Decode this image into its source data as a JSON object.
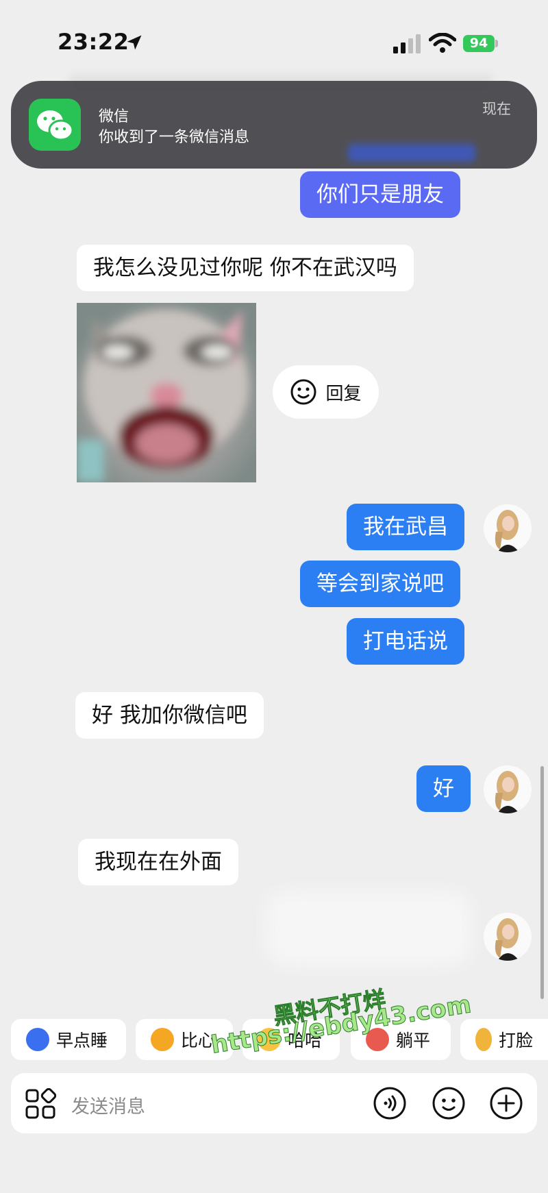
{
  "status_bar": {
    "time": "23:22",
    "battery": "94"
  },
  "notification": {
    "app": "微信",
    "message": "你收到了一条微信消息",
    "time": "现在",
    "icon": "wechat-icon"
  },
  "messages": [
    {
      "side": "sent",
      "text": "你们只是朋友"
    },
    {
      "side": "received",
      "text": "我怎么没见过你呢 你不在武汉吗"
    },
    {
      "side": "received",
      "type": "sticker",
      "description": "cat-sticker"
    },
    {
      "side": "sent",
      "text": "我在武昌"
    },
    {
      "side": "sent",
      "text": "等会到家说吧"
    },
    {
      "side": "sent",
      "text": "打电话说"
    },
    {
      "side": "received",
      "text": "好 我加你微信吧"
    },
    {
      "side": "sent",
      "text": "好"
    },
    {
      "side": "received",
      "text": "我现在在外面"
    }
  ],
  "reply_button": {
    "label": "回复"
  },
  "quick_replies": [
    {
      "label": "早点睡",
      "color": "#3a6ff0"
    },
    {
      "label": "比心",
      "color": "#f5a623"
    },
    {
      "label": "哈哈",
      "color": "#f6c342"
    },
    {
      "label": "躺平",
      "color": "#e85a4f"
    },
    {
      "label": "打脸",
      "color": "#f0b43a"
    }
  ],
  "watermark": {
    "line1": "黑料不打烊",
    "line2": "https://ebdy43.com"
  },
  "input": {
    "placeholder": "发送消息"
  },
  "colors": {
    "sent_bubble": "#2b7ff3",
    "sent_bubble_alt": "#5b6af2",
    "background": "#eeeeee"
  }
}
